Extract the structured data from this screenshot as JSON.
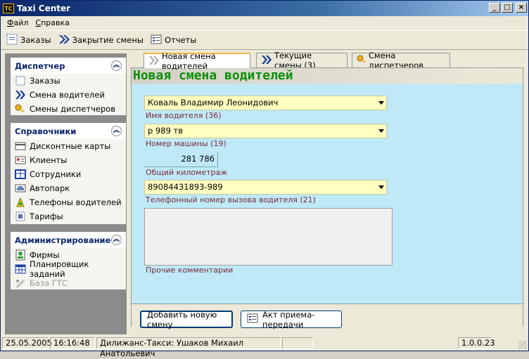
{
  "window": {
    "title": "Taxi Center",
    "icon_label": "TC"
  },
  "menubar": {
    "items": [
      {
        "label": "Файл"
      },
      {
        "label": "Справка"
      }
    ]
  },
  "toolbar": {
    "items": [
      {
        "label": "Заказы",
        "icon": "orders-icon"
      },
      {
        "label": "Закрытие смены",
        "icon": "double-arrow-icon"
      },
      {
        "label": "Отчеты",
        "icon": "reports-icon"
      }
    ]
  },
  "sidebar": {
    "groups": [
      {
        "title": "Диспетчер",
        "items": [
          {
            "label": "Заказы",
            "icon": "orders-icon"
          },
          {
            "label": "Смена водителей",
            "icon": "double-arrow-icon"
          },
          {
            "label": "Смены диспетчеров",
            "icon": "key-icon"
          }
        ]
      },
      {
        "title": "Справочники",
        "items": [
          {
            "label": "Дисконтные карты",
            "icon": "card-icon"
          },
          {
            "label": "Клиенты",
            "icon": "id-card-icon"
          },
          {
            "label": "Сотрудники",
            "icon": "table-icon"
          },
          {
            "label": "Автопарк",
            "icon": "car-icon"
          },
          {
            "label": "Телефоны водителей",
            "icon": "phone-icon"
          },
          {
            "label": "Тарифы",
            "icon": "tariff-icon"
          }
        ]
      },
      {
        "title": "Администрирование",
        "items": [
          {
            "label": "Фирмы",
            "icon": "firm-icon"
          },
          {
            "label": "Планировщик заданий",
            "icon": "scheduler-icon"
          },
          {
            "label": "База ГТС",
            "icon": "database-icon",
            "disabled": true
          }
        ]
      }
    ]
  },
  "tabs": [
    {
      "label": "Новая смена водителей",
      "active": true
    },
    {
      "label": "Текущие смены (3)"
    },
    {
      "label": "Смена диспетчеров"
    }
  ],
  "form": {
    "heading": "Новая смена водителей",
    "driver": {
      "value": "Коваль Владимир Леонидович",
      "label": "Имя водителя (36)"
    },
    "car": {
      "value": "р 989 тв",
      "label": "Номер машины (19)"
    },
    "mileage": {
      "value": "281 786",
      "label": "Общий километраж"
    },
    "phone": {
      "value": "89084431893-989",
      "label": "Телефонный номер вызова водителя (21)"
    },
    "comments": {
      "value": "",
      "label": "Прочие комментарии"
    },
    "add_button": "Добавить новую смену",
    "act_button": "Акт приема-передачи"
  },
  "statusbar": {
    "date": "25.05.2005",
    "time": "16:16:48",
    "user": "Дилижанс-Такси: Ушаков Михаил Анатольевич",
    "version": "1.0.0.23"
  },
  "colors": {
    "heading_text": "#0a8f0a",
    "field_bg": "#ffffc0",
    "content_bg": "#bfe9f7",
    "label_text": "#7a2a3a"
  }
}
